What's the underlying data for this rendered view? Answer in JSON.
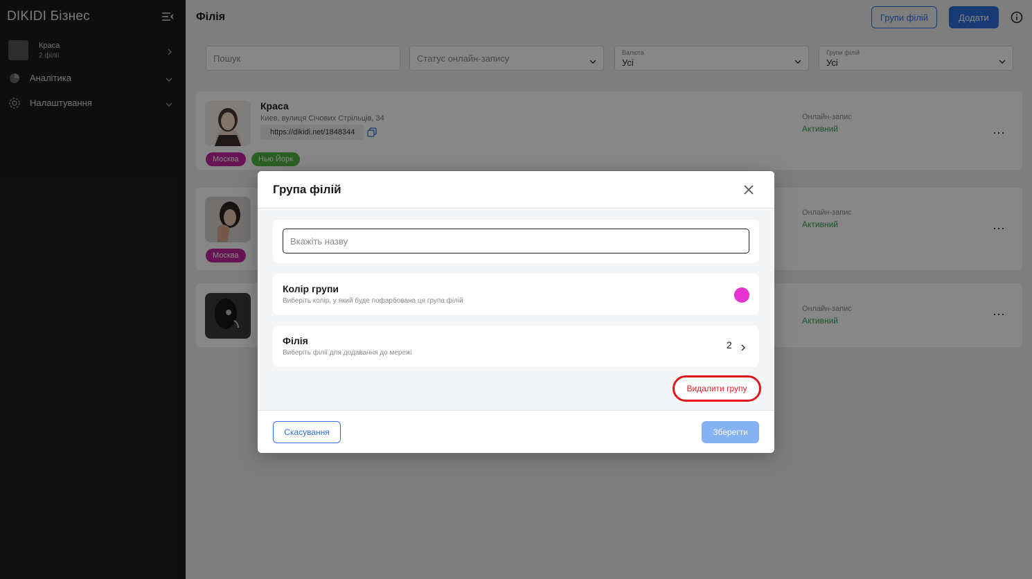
{
  "sidebar": {
    "brand": "DIKIDI Бізнес",
    "account": {
      "name": "Краса",
      "sub": "2 філії"
    },
    "items": [
      {
        "label": "Аналітика",
        "icon": "chart-pie-icon"
      },
      {
        "label": "Налаштування",
        "icon": "gear-icon"
      }
    ]
  },
  "header": {
    "title": "Філія",
    "groups_button": "Групи філій",
    "add_button": "Додати"
  },
  "filters": {
    "search_placeholder": "Пошук",
    "status_placeholder": "Статус онлайн-запису",
    "currency": {
      "label": "Валюта",
      "value": "Усі"
    },
    "groups": {
      "label": "Групи філій",
      "value": "Усі"
    }
  },
  "branches": [
    {
      "title": "Краса",
      "address": "Киев, вулиця Січових Стрільців, 34",
      "link": "https://dikidi.net/1848344",
      "tags": [
        "Москва",
        "Нью Йорк"
      ],
      "online_label": "Онлайн-запис",
      "online_value": "Активний"
    },
    {
      "tags": [
        "Москва"
      ],
      "online_label": "Онлайн-запис",
      "online_value": "Активний"
    },
    {
      "online_label": "Онлайн-запис",
      "online_value": "Активний"
    }
  ],
  "modal": {
    "title": "Група філій",
    "name_placeholder": "Вкажіть назву",
    "color": {
      "title": "Колір групи",
      "desc": "Виберіть колір, у який буде пофарбована ця група філій",
      "value": "#e433cf"
    },
    "branches": {
      "title": "Філія",
      "desc": "Виберіть філії для додавання до мережі",
      "count": "2"
    },
    "delete_button": "Видалити групу",
    "cancel_button": "Скасування",
    "save_button": "Зберегти"
  },
  "colors": {
    "accent": "#2f6fdc",
    "tag_magenta": "#c0279e",
    "tag_green": "#52b545",
    "active_green": "#2e9c4a",
    "danger": "#e0161b"
  }
}
